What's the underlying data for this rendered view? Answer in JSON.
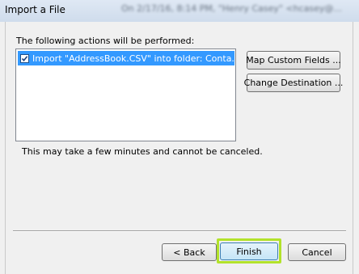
{
  "window": {
    "title": "Import a File",
    "background_caption": "On 2/17/16, 8:14 PM, \"Henry Casey\" <hcasey@..."
  },
  "dialog": {
    "heading": "The following actions will be performed:",
    "actions": [
      {
        "label": "Import \"AddressBook.CSV\" into folder: Conta...",
        "checked": true,
        "selected": true
      }
    ],
    "note": "This may take a few minutes and cannot be canceled."
  },
  "buttons": {
    "map_custom_fields": "Map Custom Fields ...",
    "change_destination": "Change Destination ...",
    "back": "< Back",
    "finish": "Finish",
    "cancel": "Cancel"
  },
  "colors": {
    "selection": "#3399ff",
    "highlight": "#b2e22a"
  }
}
